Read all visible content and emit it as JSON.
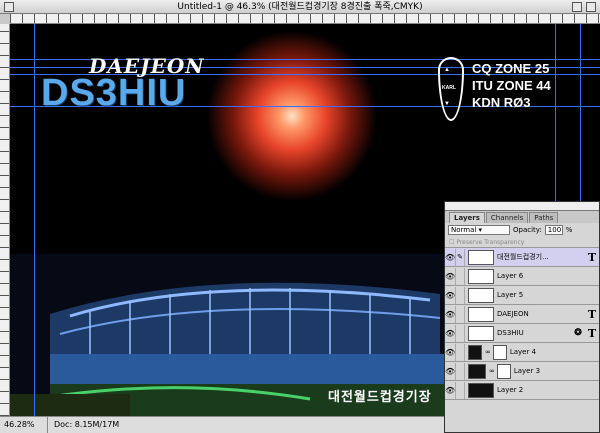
{
  "window": {
    "title": "Untitled-1 @ 46.3% (대전월드컵경기장 8경진출 폭죽,CMYK)"
  },
  "canvas": {
    "callsign_small": "DAEJEON",
    "callsign_large": "DS3HIU",
    "zone_lines": [
      "CQ ZONE 25",
      "ITU ZONE 44",
      "KDN RØ3"
    ],
    "karl_label": "KARL",
    "caption": "대전월드컵경기장"
  },
  "status": {
    "zoom": "46.28%",
    "doc": "Doc: 8.15M/17M"
  },
  "layers_panel": {
    "tabs": [
      "Layers",
      "Channels",
      "Paths"
    ],
    "blend_mode": "Normal",
    "opacity_label": "Opacity:",
    "opacity_value": "100",
    "opacity_unit": "%",
    "preserve_label": "Preserve Transparency",
    "layers": [
      {
        "name": "대전월드컵경기...",
        "type": "text",
        "selected": true
      },
      {
        "name": "Layer 6",
        "type": "pixel",
        "selected": false
      },
      {
        "name": "Layer 5",
        "type": "pixel",
        "selected": false
      },
      {
        "name": "DAEJEON",
        "type": "text",
        "selected": false
      },
      {
        "name": "DS3HIU",
        "type": "text",
        "selected": false
      },
      {
        "name": "Layer 4",
        "type": "masked",
        "selected": false
      },
      {
        "name": "Layer 3",
        "type": "masked",
        "selected": false
      },
      {
        "name": "Layer 2",
        "type": "pixel",
        "selected": false
      }
    ]
  },
  "colors": {
    "guide": "#3a6cff",
    "callsign_blue": "#5aa9ea",
    "selected_layer": "#d3cfee"
  }
}
